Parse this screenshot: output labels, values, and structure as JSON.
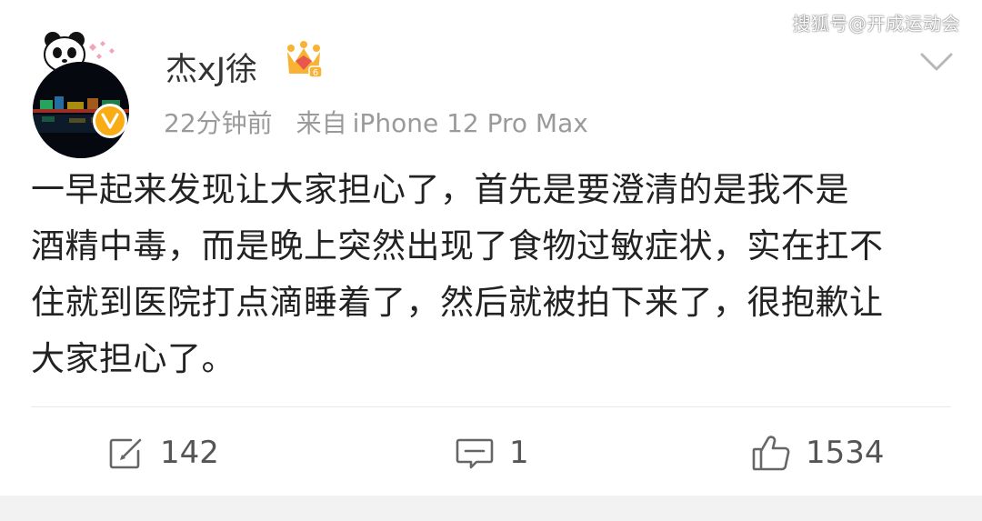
{
  "watermark": "搜狐号@开成运动会",
  "post": {
    "username": "杰xJ徐",
    "timestamp": "22分钟前",
    "source_prefix": "来自",
    "source_device": "iPhone 12 Pro Max",
    "lines": [
      "一早起来发现让大家担心了，首先是要澄清的是我不是",
      "酒精中毒，而是晚上突然出现了食物过敏症状，实在扛不",
      "住就到医院打点滴睡着了，然后就被拍下来了，很抱歉让",
      "大家担心了。"
    ]
  },
  "actions": {
    "repost": {
      "icon": "repost-icon",
      "count": "142"
    },
    "comment": {
      "icon": "comment-icon",
      "count": "1"
    },
    "like": {
      "icon": "like-icon",
      "count": "1534"
    }
  },
  "colors": {
    "verified": "#f9ac14",
    "meta_text": "#9a9a9a",
    "body_text": "#222222"
  }
}
